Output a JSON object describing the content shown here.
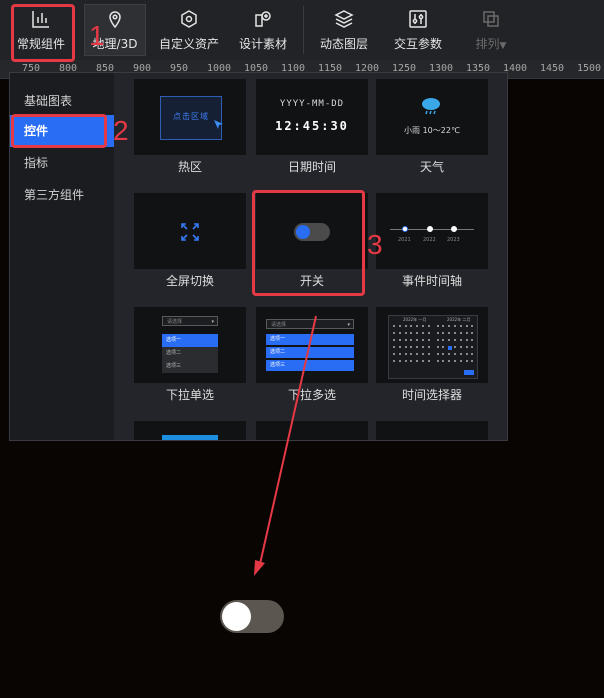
{
  "toolbar": {
    "items": [
      {
        "label": "常规组件",
        "icon": "bar-chart-icon"
      },
      {
        "label": "地理/3D",
        "icon": "map-pin-icon"
      },
      {
        "label": "自定义资产",
        "icon": "hexagon-icon"
      },
      {
        "label": "设计素材",
        "icon": "material-icon"
      },
      {
        "label": "动态图层",
        "icon": "layers-icon"
      },
      {
        "label": "交互参数",
        "icon": "sliders-icon"
      },
      {
        "label": "排列",
        "icon": "arrange-icon",
        "disabled": true
      }
    ]
  },
  "ruler": {
    "ticks": [
      "750",
      "800",
      "850",
      "900",
      "950",
      "1000",
      "1050",
      "1100",
      "1150",
      "1200",
      "1250",
      "1300",
      "1350",
      "1400",
      "1450",
      "1500"
    ]
  },
  "categories": [
    {
      "label": "基础图表"
    },
    {
      "label": "控件",
      "active": true
    },
    {
      "label": "指标"
    },
    {
      "label": "第三方组件"
    }
  ],
  "components": [
    {
      "label": "热区",
      "preview_text": "点击区域"
    },
    {
      "label": "日期时间",
      "preview_date": "YYYY-MM-DD",
      "preview_time": "12:45:30"
    },
    {
      "label": "天气",
      "preview_text": "小雨 10～22℃"
    },
    {
      "label": "全屏切换"
    },
    {
      "label": "开关"
    },
    {
      "label": "事件时间轴",
      "timeline_years": [
        "2021",
        "2022",
        "2023"
      ]
    },
    {
      "label": "下拉单选",
      "placeholder": "请选择",
      "options": [
        "选项一",
        "选项二",
        "选项三"
      ]
    },
    {
      "label": "下拉多选",
      "placeholder": "请选择",
      "options": [
        "选项一",
        "选项二",
        "选项三"
      ]
    },
    {
      "label": "时间选择器",
      "header_left": "2022年 一月",
      "header_right": "2022年 二月"
    }
  ],
  "annotations": [
    "1",
    "2",
    "3"
  ],
  "colors": {
    "accent": "#2a6df5",
    "annotation": "#e53945",
    "toggle_track": "#5b5650"
  }
}
